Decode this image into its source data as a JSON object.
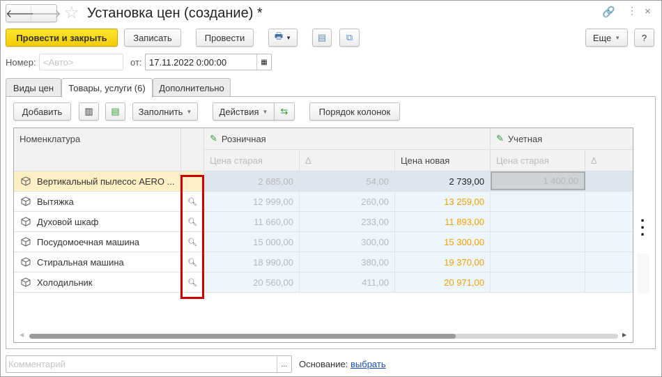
{
  "window": {
    "title": "Установка цен (создание) *"
  },
  "toolbar": {
    "post_close": "Провести и закрыть",
    "save": "Записать",
    "post": "Провести",
    "more": "Еще",
    "help": "?"
  },
  "header": {
    "number_label": "Номер:",
    "number_placeholder": "<Авто>",
    "date_label": "от:",
    "date_value": "17.11.2022  0:00:00"
  },
  "tabs": [
    {
      "label": "Виды цен"
    },
    {
      "label": "Товары, услуги (6)",
      "active": true
    },
    {
      "label": "Дополнительно"
    }
  ],
  "grid_toolbar": {
    "add": "Добавить",
    "fill": "Заполнить",
    "actions": "Действия",
    "column_order": "Порядок колонок"
  },
  "grid": {
    "col_name": "Номенклатура",
    "groups": [
      {
        "label": "Розничная"
      },
      {
        "label": "Учетная"
      }
    ],
    "sub": {
      "old": "Цена старая",
      "delta": "Δ",
      "new": "Цена новая"
    },
    "rows": [
      {
        "name": "Вертикальный пылесос AERO ...",
        "old": "2 685,00",
        "delta": "54,00",
        "new": "2 739,00",
        "acc_old": "1 400,00",
        "selected": true
      },
      {
        "name": "Вытяжка",
        "old": "12 999,00",
        "delta": "260,00",
        "new": "13 259,00",
        "acc_old": ""
      },
      {
        "name": "Духовой шкаф",
        "old": "11 660,00",
        "delta": "233,00",
        "new": "11 893,00",
        "acc_old": ""
      },
      {
        "name": "Посудомоечная машина",
        "old": "15 000,00",
        "delta": "300,00",
        "new": "15 300,00",
        "acc_old": ""
      },
      {
        "name": "Стиральная машина",
        "old": "18 990,00",
        "delta": "380,00",
        "new": "19 370,00",
        "acc_old": ""
      },
      {
        "name": "Холодильник",
        "old": "20 560,00",
        "delta": "411,00",
        "new": "20 971,00",
        "acc_old": ""
      }
    ]
  },
  "footer": {
    "comment_placeholder": "Комментарий",
    "ellipsis": "...",
    "basis_label": "Основание:",
    "basis_link": "выбрать"
  },
  "colors": {
    "accent": "#f2cc00",
    "new_price": "#f5a000",
    "highlight": "#d00000",
    "link": "#1a4fb8"
  }
}
